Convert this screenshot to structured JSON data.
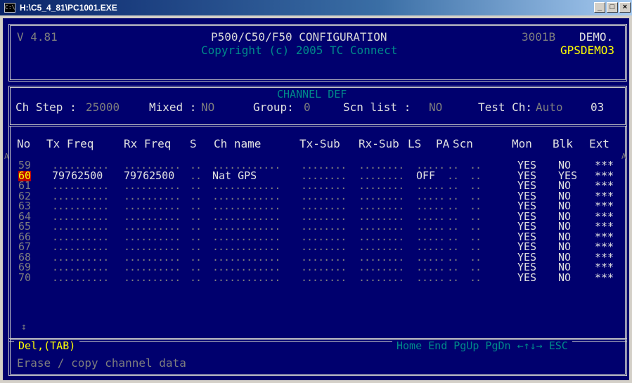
{
  "window": {
    "title": "H:\\C5_4_81\\PC1001.EXE",
    "icon": "console-icon",
    "buttons": [
      "_",
      "□",
      "×"
    ]
  },
  "header": {
    "version": "V 4.81",
    "title": "P500/C50/F50 CONFIGURATION",
    "copyright": "Copyright (c) 2005 TC Connect",
    "serial": "3001B",
    "mode": "DEMO.",
    "file": "GPSDEMO3"
  },
  "channel_def": {
    "legend": "CHANNEL DEF",
    "ch_step_label": "Ch Step :",
    "ch_step_value": "25000",
    "mixed_label": "Mixed :",
    "mixed_value": "NO",
    "group_label": "Group:",
    "group_value": "0",
    "scn_list_label": "Scn list :",
    "scn_list_value": "NO",
    "test_ch_label": "Test Ch:",
    "test_ch_value": "Auto",
    "test_ch_num": "03"
  },
  "table": {
    "columns": [
      "No",
      "Tx Freq",
      "Rx Freq",
      "S",
      "Ch name",
      "Tx-Sub",
      "Rx-Sub",
      "LS",
      "PA",
      "Scn",
      "Mon",
      "Blk",
      "Ext"
    ],
    "selected_row": "60",
    "rows": [
      {
        "no": "59",
        "tx": "..........",
        "rx": "..........",
        "s": "..",
        "name": "............",
        "txsub": "........",
        "rxsub": "........",
        "ls": ".....",
        "pa": "..",
        "scn": "..",
        "mon": "YES",
        "blk": "NO",
        "ext": "***"
      },
      {
        "no": "60",
        "tx": "79762500",
        "rx": "79762500",
        "s": "..",
        "name": "Nat GPS",
        "txsub": "........",
        "rxsub": "........",
        "ls": "OFF",
        "pa": "..",
        "scn": "..",
        "mon": "YES",
        "blk": "YES",
        "ext": "***"
      },
      {
        "no": "61",
        "tx": "..........",
        "rx": "..........",
        "s": "..",
        "name": "............",
        "txsub": "........",
        "rxsub": "........",
        "ls": ".....",
        "pa": "..",
        "scn": "..",
        "mon": "YES",
        "blk": "NO",
        "ext": "***"
      },
      {
        "no": "62",
        "tx": "..........",
        "rx": "..........",
        "s": "..",
        "name": "............",
        "txsub": "........",
        "rxsub": "........",
        "ls": ".....",
        "pa": "..",
        "scn": "..",
        "mon": "YES",
        "blk": "NO",
        "ext": "***"
      },
      {
        "no": "63",
        "tx": "..........",
        "rx": "..........",
        "s": "..",
        "name": "............",
        "txsub": "........",
        "rxsub": "........",
        "ls": ".....",
        "pa": "..",
        "scn": "..",
        "mon": "YES",
        "blk": "NO",
        "ext": "***"
      },
      {
        "no": "64",
        "tx": "..........",
        "rx": "..........",
        "s": "..",
        "name": "............",
        "txsub": "........",
        "rxsub": "........",
        "ls": ".....",
        "pa": "..",
        "scn": "..",
        "mon": "YES",
        "blk": "NO",
        "ext": "***"
      },
      {
        "no": "65",
        "tx": "..........",
        "rx": "..........",
        "s": "..",
        "name": "............",
        "txsub": "........",
        "rxsub": "........",
        "ls": ".....",
        "pa": "..",
        "scn": "..",
        "mon": "YES",
        "blk": "NO",
        "ext": "***"
      },
      {
        "no": "66",
        "tx": "..........",
        "rx": "..........",
        "s": "..",
        "name": "............",
        "txsub": "........",
        "rxsub": "........",
        "ls": ".....",
        "pa": "..",
        "scn": "..",
        "mon": "YES",
        "blk": "NO",
        "ext": "***"
      },
      {
        "no": "67",
        "tx": "..........",
        "rx": "..........",
        "s": "..",
        "name": "............",
        "txsub": "........",
        "rxsub": "........",
        "ls": ".....",
        "pa": "..",
        "scn": "..",
        "mon": "YES",
        "blk": "NO",
        "ext": "***"
      },
      {
        "no": "68",
        "tx": "..........",
        "rx": "..........",
        "s": "..",
        "name": "............",
        "txsub": "........",
        "rxsub": "........",
        "ls": ".....",
        "pa": "..",
        "scn": "..",
        "mon": "YES",
        "blk": "NO",
        "ext": "***"
      },
      {
        "no": "69",
        "tx": "..........",
        "rx": "..........",
        "s": "..",
        "name": "............",
        "txsub": "........",
        "rxsub": "........",
        "ls": ".....",
        "pa": "..",
        "scn": "..",
        "mon": "YES",
        "blk": "NO",
        "ext": "***"
      },
      {
        "no": "70",
        "tx": "..........",
        "rx": "..........",
        "s": "..",
        "name": "............",
        "txsub": "........",
        "rxsub": "........",
        "ls": ".....",
        "pa": "..",
        "scn": "..",
        "mon": "YES",
        "blk": "NO",
        "ext": "***"
      }
    ]
  },
  "footer": {
    "keys_legend": "Del,(TAB)",
    "nav_keys": "Home End PgUp PgDn ←↑↓→ ESC",
    "help_text": "Erase / copy channel data"
  },
  "markers": {
    "left": "A",
    "right": "A",
    "scroll": "↕"
  },
  "colors": {
    "background": "#00006e",
    "text": "#c8c8c8",
    "highlight": "#ffff00",
    "accent": "#008a8a",
    "selected_bg": "#b80000"
  }
}
